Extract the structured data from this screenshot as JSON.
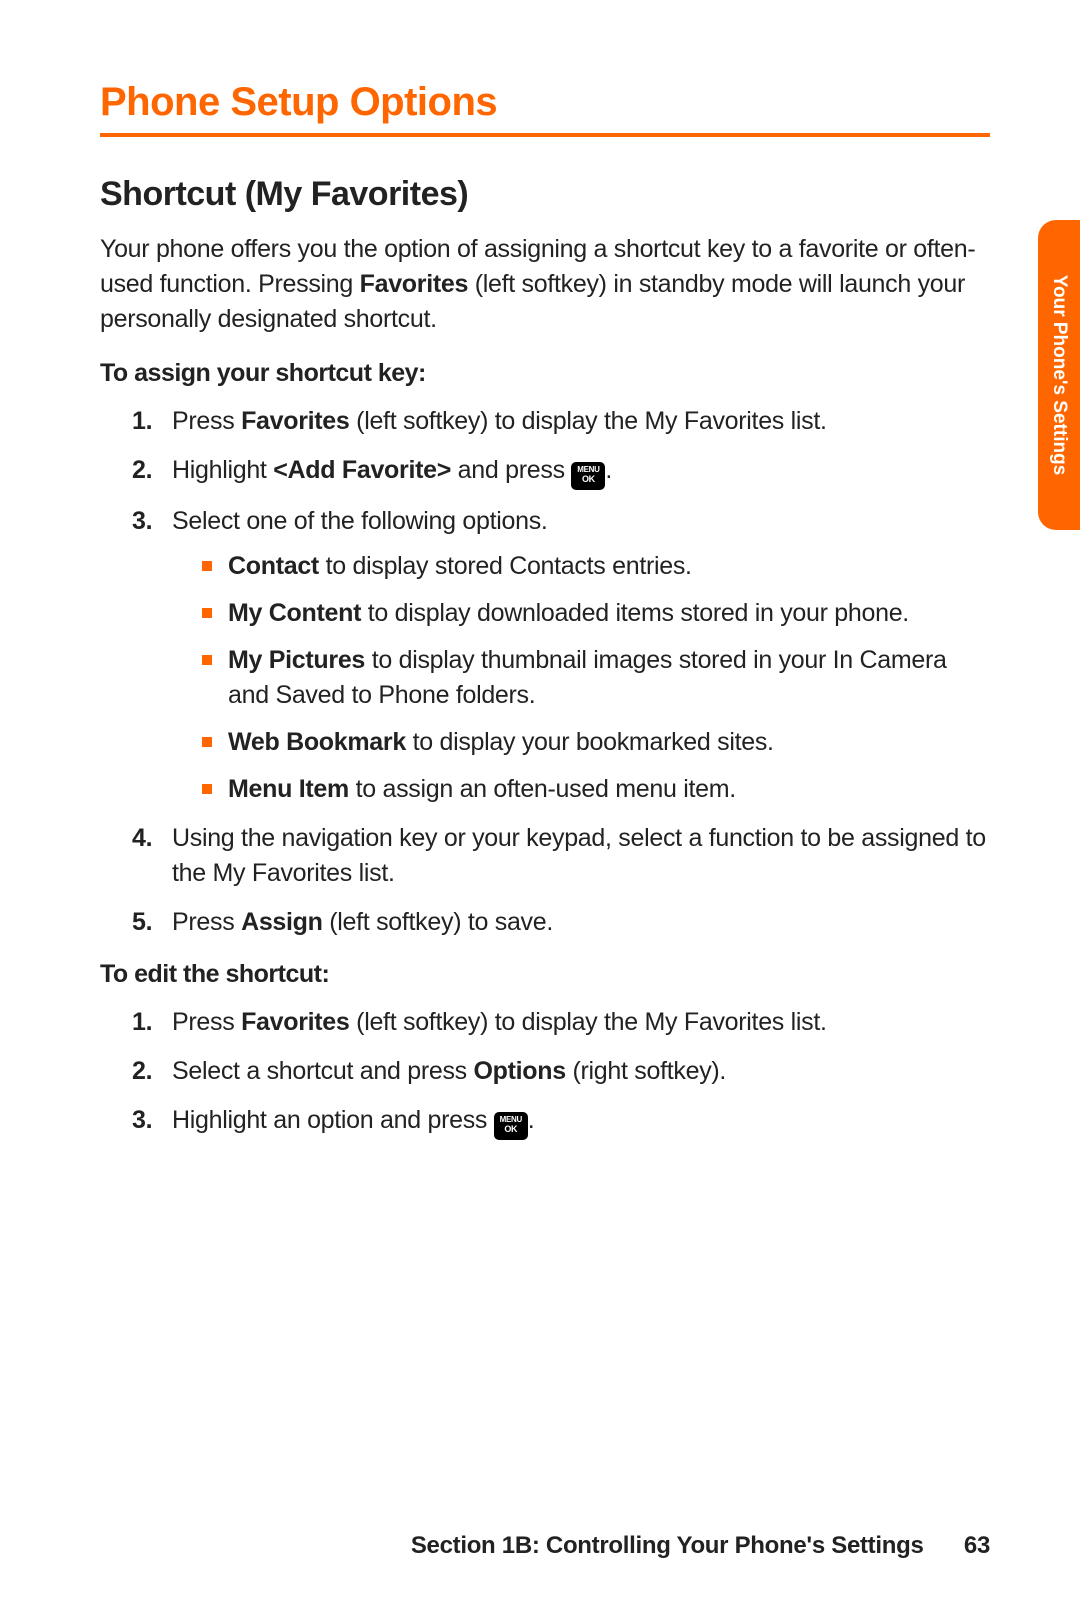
{
  "title": "Phone Setup Options",
  "section_title": "Shortcut (My Favorites)",
  "intro": {
    "pre": "Your phone offers you the option of assigning a shortcut key to a favorite or often-used function. Pressing ",
    "bold": "Favorites",
    "post": " (left softkey) in standby mode will launch your personally designated shortcut."
  },
  "assign": {
    "heading": "To assign your shortcut key:",
    "step1": {
      "num": "1.",
      "pre": "Press ",
      "bold": "Favorites",
      "post": " (left softkey) to display the My Favorites list."
    },
    "step2": {
      "num": "2.",
      "pre": "Highlight ",
      "bold": "<Add Favorite>",
      "post": " and press ",
      "trail": "."
    },
    "step3": {
      "num": "3.",
      "text": "Select one of the following options."
    },
    "opts": {
      "contact": {
        "bold": "Contact",
        "post": " to display stored Contacts entries."
      },
      "mycontent": {
        "bold": "My Content",
        "post": " to display downloaded items stored in your phone."
      },
      "mypics": {
        "bold": "My Pictures",
        "post": " to display thumbnail images stored in your In Camera and Saved to Phone folders."
      },
      "web": {
        "bold": "Web Bookmark",
        "post": " to display your bookmarked sites."
      },
      "menu": {
        "bold": "Menu Item",
        "post": " to assign an often-used menu item."
      }
    },
    "step4": {
      "num": "4.",
      "text": "Using the navigation key or your keypad, select a function to be assigned to the My Favorites list."
    },
    "step5": {
      "num": "5.",
      "pre": "Press ",
      "bold": "Assign",
      "post": " (left softkey) to save."
    }
  },
  "edit": {
    "heading": "To edit the shortcut:",
    "step1": {
      "num": "1.",
      "pre": "Press ",
      "bold": "Favorites",
      "post": " (left softkey) to display the My Favorites list."
    },
    "step2": {
      "num": "2.",
      "pre": "Select a shortcut and press ",
      "bold": "Options",
      "post": " (right softkey)."
    },
    "step3": {
      "num": "3.",
      "pre": "Highlight an option and press ",
      "trail": "."
    }
  },
  "icon": {
    "top": "MENU",
    "bottom": "OK"
  },
  "sidetab": "Your Phone's Settings",
  "footer": {
    "text": "Section 1B: Controlling Your Phone's Settings",
    "page": "63"
  }
}
